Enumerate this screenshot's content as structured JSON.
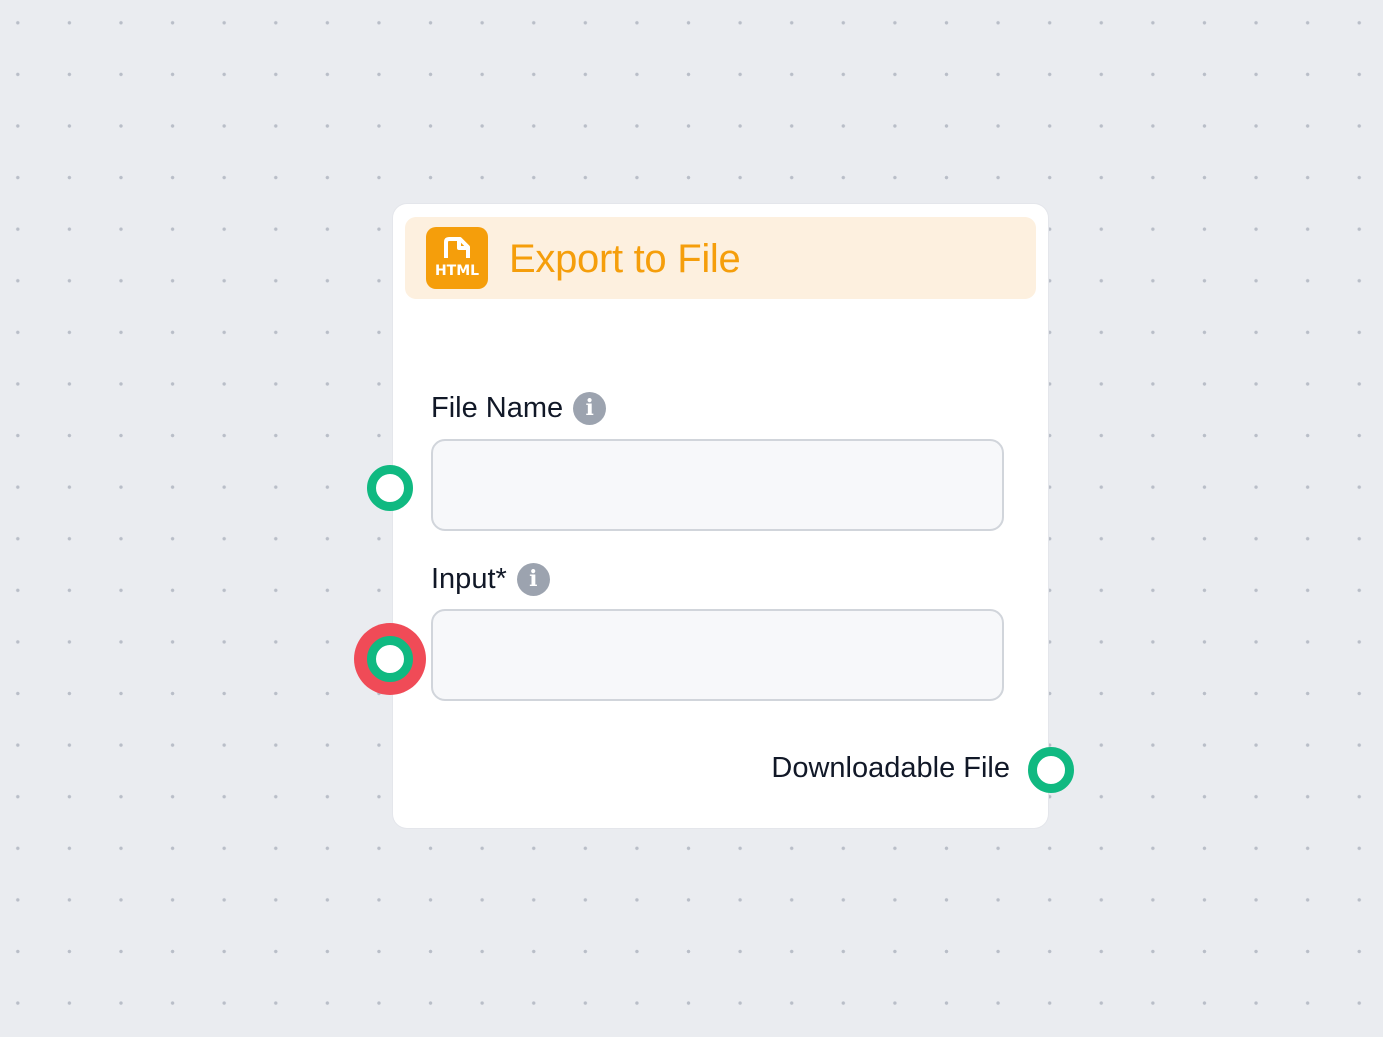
{
  "node": {
    "title": "Export to File",
    "icon": "html-file-icon",
    "icon_text": "HTML",
    "accent_color": "#f59e0b",
    "header_bg": "#fdf0df"
  },
  "fields": {
    "file_name": {
      "label": "File Name",
      "value": "",
      "placeholder": ""
    },
    "input": {
      "label": "Input*",
      "value": "",
      "placeholder": ""
    }
  },
  "output": {
    "label": "Downloadable File"
  },
  "colors": {
    "handle": "#10b981",
    "handle_error": "#f04b57",
    "info_icon": "#9ca3af"
  }
}
